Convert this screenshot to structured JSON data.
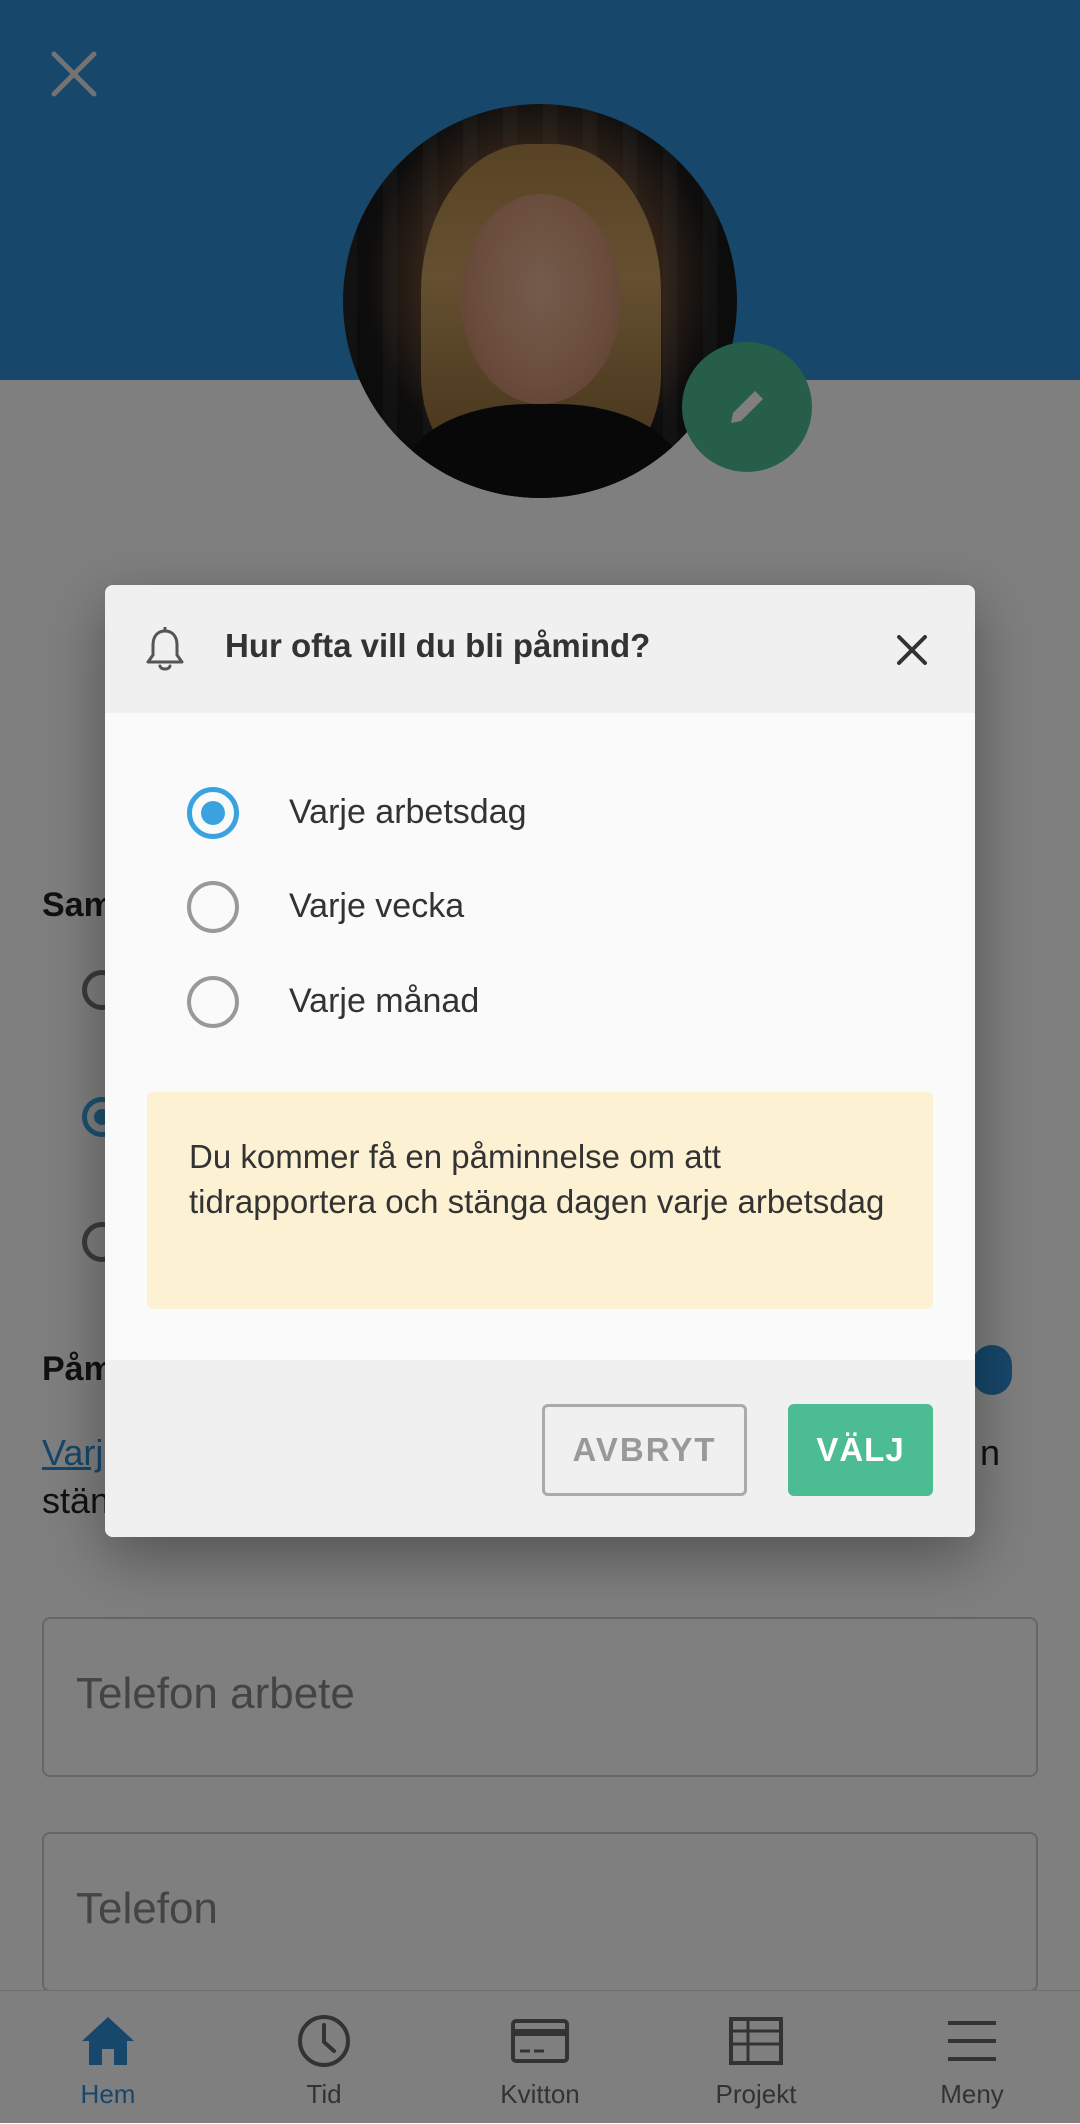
{
  "background": {
    "section_label_1": "Sam",
    "section_label_2": "Påm",
    "link_text": "Varj",
    "text_line_2": "stän",
    "text_fragment_right": "n",
    "fields": [
      {
        "placeholder": "Telefon arbete"
      },
      {
        "placeholder": "Telefon"
      }
    ]
  },
  "bottom_nav": {
    "items": [
      {
        "label": "Hem",
        "icon": "home-icon",
        "active": true
      },
      {
        "label": "Tid",
        "icon": "clock-icon",
        "active": false
      },
      {
        "label": "Kvitton",
        "icon": "receipt-card-icon",
        "active": false
      },
      {
        "label": "Projekt",
        "icon": "table-icon",
        "active": false
      },
      {
        "label": "Meny",
        "icon": "menu-icon",
        "active": false
      }
    ]
  },
  "dialog": {
    "title": "Hur ofta vill du bli påmind?",
    "options": [
      {
        "label": "Varje arbetsdag",
        "selected": true
      },
      {
        "label": "Varje vecka",
        "selected": false
      },
      {
        "label": "Varje månad",
        "selected": false
      }
    ],
    "info": "Du kommer få en påminnelse om att tidrapportera och stänga dagen varje arbetsdag",
    "cancel_label": "AVBRYT",
    "confirm_label": "VÄLJ"
  },
  "colors": {
    "header": "#2e8fd6",
    "accent_green": "#4cbd93",
    "radio_selected": "#3aa3df",
    "info_background": "#fcf2d3"
  }
}
